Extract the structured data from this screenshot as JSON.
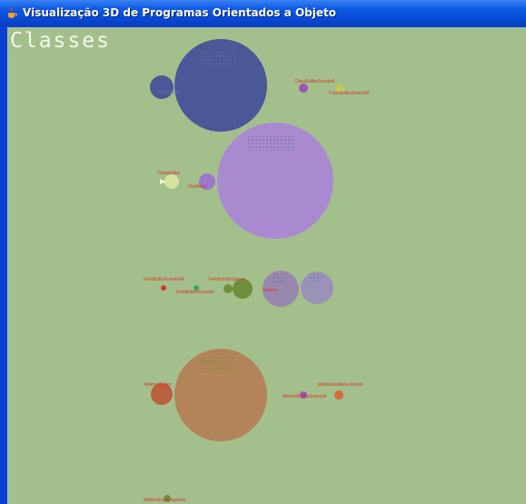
{
  "window": {
    "title": "Visualização 3D de Programas Orientados a Objeto",
    "icon": "java-cup-icon"
  },
  "scene": {
    "heading": "Classes",
    "background": "#a3c08c",
    "labels": {
      "class_editor": "ClassEditor",
      "class_editor_event_a": "ClassEditorEventsA",
      "class_editor_event_b": "ClassEditorEventsB",
      "class_item": "ClassItem",
      "field_item": "FieldItem",
      "field_editor_event_a": "FieldEditorEventsAF",
      "field_inside_sphere": "FieldInsideSphere",
      "field_editor_event_b": "FieldEditorEventsF",
      "sphere": "Sphere",
      "method_editor": "MethodEditor",
      "method_editor_event_a": "MethodEditorEventsM",
      "method_editor_event_b": "MethodEditorEventsA",
      "method_inside_sphere": "MethodInsideSphere"
    },
    "colors": {
      "navy": "#4a5898",
      "lilac": "#a98ad0",
      "olive": "#6f8e3c",
      "grey_purple": "#9888ae",
      "brown": "#b38459",
      "label_red": "#d9342b"
    }
  }
}
